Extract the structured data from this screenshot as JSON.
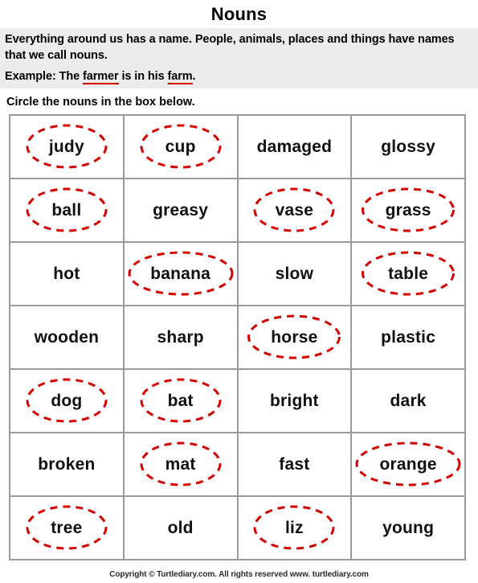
{
  "title": "Nouns",
  "intro": {
    "paragraph": "Everything around us has a name. People, animals, places and things have names that we call nouns.",
    "example_prefix": "Example: The ",
    "example_word1": "farmer",
    "example_middle": " is in his ",
    "example_word2": "farm",
    "example_suffix": "."
  },
  "directive": "Circle the nouns in the box below.",
  "colors": {
    "circle_red": "#d40000",
    "grid_border": "#9a9a9a",
    "panel_bg": "#ececec"
  },
  "grid": {
    "rows": [
      [
        {
          "word": "judy",
          "circled": true
        },
        {
          "word": "cup",
          "circled": true
        },
        {
          "word": "damaged",
          "circled": false
        },
        {
          "word": "glossy",
          "circled": false
        }
      ],
      [
        {
          "word": "ball",
          "circled": true
        },
        {
          "word": "greasy",
          "circled": false
        },
        {
          "word": "vase",
          "circled": true
        },
        {
          "word": "grass",
          "circled": true
        }
      ],
      [
        {
          "word": "hot",
          "circled": false
        },
        {
          "word": "banana",
          "circled": true
        },
        {
          "word": "slow",
          "circled": false
        },
        {
          "word": "table",
          "circled": true
        }
      ],
      [
        {
          "word": "wooden",
          "circled": false
        },
        {
          "word": "sharp",
          "circled": false
        },
        {
          "word": "horse",
          "circled": true
        },
        {
          "word": "plastic",
          "circled": false
        }
      ],
      [
        {
          "word": "dog",
          "circled": true
        },
        {
          "word": "bat",
          "circled": true
        },
        {
          "word": "bright",
          "circled": false
        },
        {
          "word": "dark",
          "circled": false
        }
      ],
      [
        {
          "word": "broken",
          "circled": false
        },
        {
          "word": "mat",
          "circled": true
        },
        {
          "word": "fast",
          "circled": false
        },
        {
          "word": "orange",
          "circled": true
        }
      ],
      [
        {
          "word": "tree",
          "circled": true
        },
        {
          "word": "old",
          "circled": false
        },
        {
          "word": "liz",
          "circled": true
        },
        {
          "word": "young",
          "circled": false
        }
      ]
    ]
  },
  "footer": "Copyright © Turtlediary.com. All rights reserved  www. turtlediary.com"
}
